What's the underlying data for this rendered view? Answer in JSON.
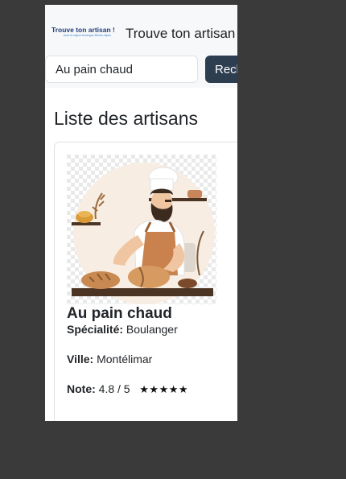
{
  "navbar": {
    "logo_text": "Trouve ton artisan !",
    "logo_subtext": "Avec la région Auvergne-Rhône-Alpes",
    "site_title": "Trouve ton artisan"
  },
  "search": {
    "value": "Au pain chaud",
    "button_label": "Rechercher"
  },
  "page_title": "Liste des artisans",
  "artisans": [
    {
      "name": "Au pain chaud",
      "specialty_label": "Spécialité:",
      "specialty": "Boulanger",
      "city_label": "Ville:",
      "city": "Montélimar",
      "rating_label": "Note:",
      "rating": "4.8 / 5",
      "stars": "★★★★★",
      "image_icon": "baker-illustration"
    }
  ],
  "colors": {
    "page_background": "#3a3a3a",
    "navbar_background": "#f7f8fa",
    "button_background": "#2c3e50",
    "logo_primary": "#1f3d78",
    "logo_secondary": "#3a85c8"
  }
}
